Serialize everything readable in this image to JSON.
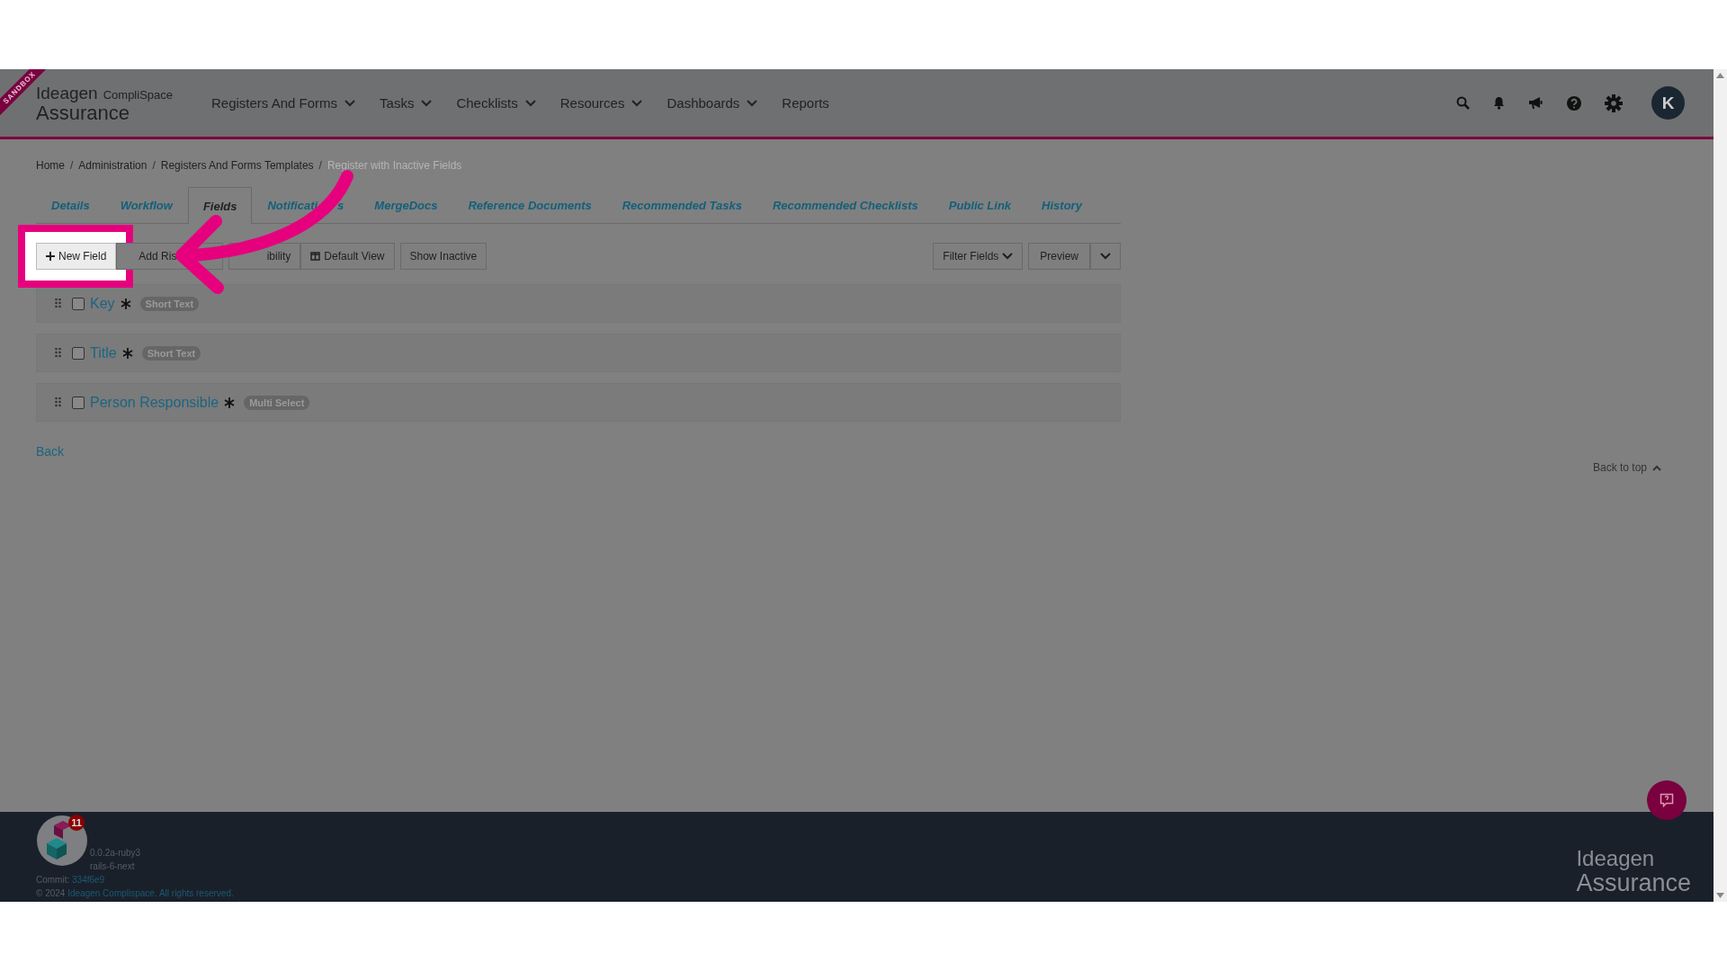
{
  "ribbon": "SANDBOX",
  "logo": {
    "brand": "Ideagen",
    "product": "CompliSpace",
    "suite": "Assurance"
  },
  "nav": [
    {
      "label": "Registers And Forms",
      "dropdown": true
    },
    {
      "label": "Tasks",
      "dropdown": true
    },
    {
      "label": "Checklists",
      "dropdown": true
    },
    {
      "label": "Resources",
      "dropdown": true
    },
    {
      "label": "Dashboards",
      "dropdown": true
    },
    {
      "label": "Reports",
      "dropdown": false
    }
  ],
  "avatar": "K",
  "breadcrumb": [
    {
      "label": "Home"
    },
    {
      "separator": "/",
      "label": "Administration"
    },
    {
      "separator": "/",
      "label": "Registers And Forms Templates"
    },
    {
      "separator": "/",
      "label": "Register with Inactive Fields"
    }
  ],
  "tabs": [
    {
      "label": "Details",
      "selected": false
    },
    {
      "label": "Workflow",
      "selected": false
    },
    {
      "label": "Fields",
      "selected": true
    },
    {
      "label": "Notificati",
      "label_tail": "s",
      "selected": false
    },
    {
      "label": "MergeDocs",
      "selected": false
    },
    {
      "label": "Reference Documents",
      "selected": false
    },
    {
      "label": "Recommended Tasks",
      "selected": false
    },
    {
      "label": "Recommended Checklists",
      "selected": false
    },
    {
      "label": "Public Link",
      "selected": false
    },
    {
      "label": "History",
      "selected": false
    }
  ],
  "toolbar_groups": [
    [
      {
        "label": "New Field",
        "kind": "add",
        "highlighted": true
      },
      {
        "label": "Add Ris",
        "kind": "plain",
        "highlighted": false
      }
    ],
    [
      {
        "label": "ibility",
        "kind": "plain",
        "highlighted": false
      },
      {
        "label": "Default View",
        "kind": "columns",
        "highlighted": false
      }
    ],
    [
      {
        "label": "Show Inactive",
        "kind": "plain",
        "highlighted": false
      }
    ]
  ],
  "filter_button": "Filter Fields",
  "preview_button": "Preview",
  "fields": [
    {
      "label": "Key",
      "required": true,
      "checked": false,
      "type": "Short Text"
    },
    {
      "label": "Title",
      "required": true,
      "checked": false,
      "type": "Short Text"
    },
    {
      "label": "Person Responsible",
      "required": true,
      "checked": false,
      "type": "Multi Select"
    }
  ],
  "back_link": "Back",
  "back_to_top": "Back to top",
  "footer": {
    "badge": "11",
    "version": "0.0.2a-ruby3",
    "branch": "rails-6-next",
    "commit_label": "Commit:",
    "commit": "334f6e9",
    "copyright": "© 2024",
    "company_link": "Ideagen Complispace. All rights reserved."
  },
  "footer_logo": {
    "brand": "Ideagen",
    "suite": "Assurance"
  }
}
